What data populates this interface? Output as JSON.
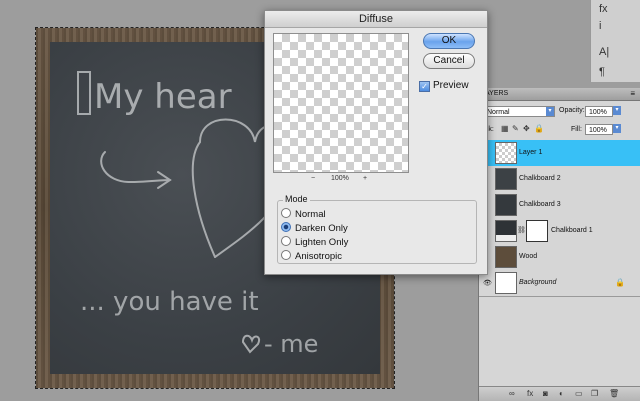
{
  "canvas": {
    "chalk_lines": [
      "My hear",
      "... you have it",
      "- me"
    ]
  },
  "dialog": {
    "title": "Diffuse",
    "ok_label": "OK",
    "cancel_label": "Cancel",
    "preview_label": "Preview",
    "preview_checked": true,
    "zoom_out": "−",
    "zoom_level": "100%",
    "zoom_in": "+",
    "mode_label": "Mode",
    "modes": [
      "Normal",
      "Darken Only",
      "Lighten Only",
      "Anisotropic"
    ],
    "selected_mode": "Darken Only"
  },
  "tool_strip": {
    "icons": [
      "fx-icon",
      "info-icon",
      "character-icon",
      "paragraph-icon"
    ],
    "fx_label": "fx",
    "info_label": "i",
    "char_label": "A|",
    "para_label": "¶"
  },
  "layers_panel": {
    "tab_label": "AYERS",
    "blend_mode": "Normal",
    "opacity_label": "Opacity:",
    "opacity_value": "100%",
    "lock_label": "ock:",
    "fill_label": "Fill:",
    "fill_value": "100%",
    "layers": [
      {
        "name": "Layer 1",
        "selected": true,
        "thumb": "transparent"
      },
      {
        "name": "Chalkboard 2",
        "selected": false,
        "thumb": "chalk"
      },
      {
        "name": "Chalkboard 3",
        "selected": false,
        "thumb": "chalk"
      },
      {
        "name": "Chalkboard 1",
        "selected": false,
        "thumb": "chalk-mask"
      },
      {
        "name": "Wood",
        "selected": false,
        "thumb": "wood"
      },
      {
        "name": "Background",
        "selected": false,
        "thumb": "white",
        "locked": true
      }
    ],
    "bottom_icons": [
      "link-icon",
      "fx-icon",
      "mask-icon",
      "adjustment-icon",
      "group-icon",
      "new-layer-icon",
      "trash-icon"
    ]
  },
  "colors": {
    "selected_layer": "#38c0f6",
    "dialog_bg": "#e8e8e8",
    "app_bg": "#9d9d9d"
  }
}
